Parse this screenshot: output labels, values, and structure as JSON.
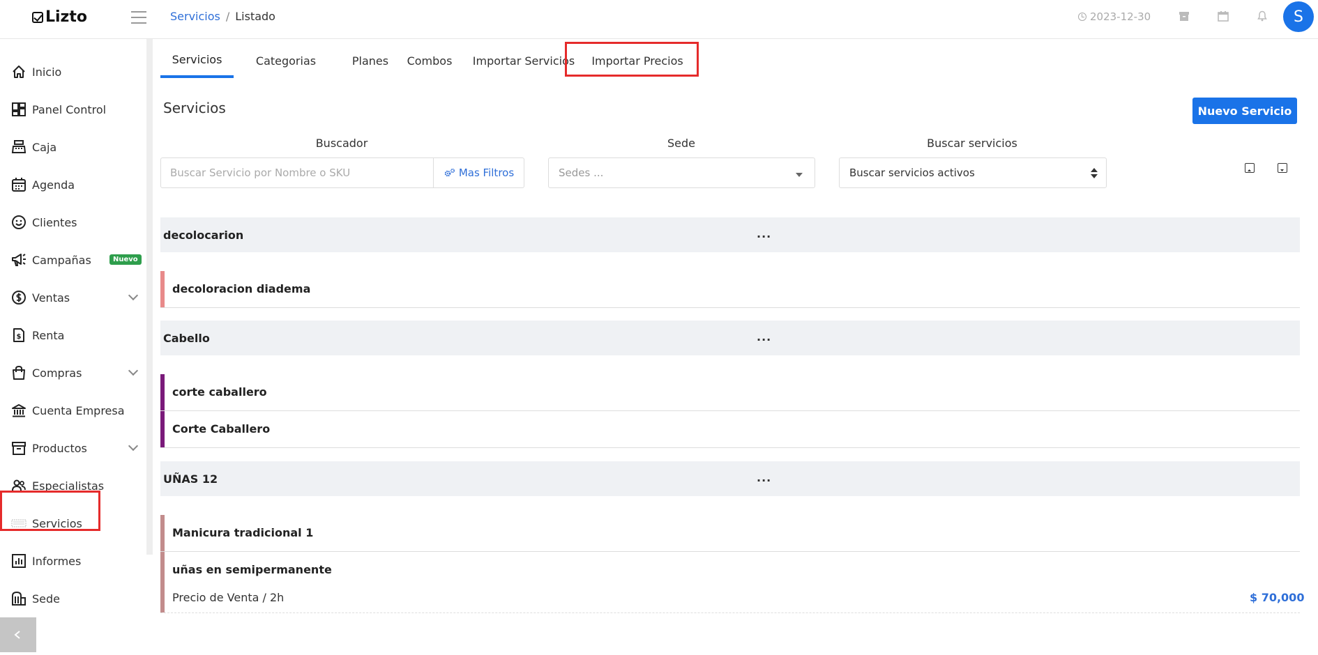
{
  "app": {
    "logo_text": "Lizto"
  },
  "breadcrumb": {
    "parent": "Servicios",
    "separator": "/",
    "current": "Listado"
  },
  "topbar": {
    "date": "2023-12-30",
    "avatar_letter": "S"
  },
  "sidebar": {
    "items": [
      {
        "label": "Inicio",
        "icon": "home-icon"
      },
      {
        "label": "Panel Control",
        "icon": "dashboard-icon"
      },
      {
        "label": "Caja",
        "icon": "cash-register-icon"
      },
      {
        "label": "Agenda",
        "icon": "calendar-icon"
      },
      {
        "label": "Clientes",
        "icon": "smiley-icon"
      },
      {
        "label": "Campañas",
        "icon": "megaphone-icon",
        "badge": "Nuevo"
      },
      {
        "label": "Ventas",
        "icon": "dollar-icon"
      },
      {
        "label": "Renta",
        "icon": "invoice-icon"
      },
      {
        "label": "Compras",
        "icon": "shopping-bag-icon"
      },
      {
        "label": "Cuenta Empresa",
        "icon": "bank-icon"
      },
      {
        "label": "Productos",
        "icon": "archive-icon"
      },
      {
        "label": "Especialistas",
        "icon": "users-icon"
      },
      {
        "label": "Servicios",
        "icon": "services-icon"
      },
      {
        "label": "Informes",
        "icon": "report-icon"
      },
      {
        "label": "Sede",
        "icon": "building-icon"
      }
    ]
  },
  "tabs": [
    {
      "label": "Servicios",
      "active": true
    },
    {
      "label": "Categorias"
    },
    {
      "label": "Planes"
    },
    {
      "label": "Combos"
    },
    {
      "label": "Importar Servicios"
    },
    {
      "label": "Importar Precios"
    }
  ],
  "main": {
    "title": "Servicios",
    "new_button": "Nuevo Servicio",
    "filters": {
      "search_label": "Buscador",
      "search_placeholder": "Buscar Servicio por Nombre o SKU",
      "more_filters": "Mas Filtros",
      "sede_label": "Sede",
      "sede_placeholder": "Sedes ...",
      "status_label": "Buscar servicios",
      "status_value": "Buscar servicios activos"
    },
    "categories": [
      {
        "name": "decolocarion",
        "menu": "...",
        "color": "#e88a8a",
        "services": [
          "decoloracion diadema"
        ]
      },
      {
        "name": "Cabello",
        "menu": "...",
        "color": "#7a1a7a",
        "services": [
          "corte caballero",
          "Corte Caballero"
        ]
      },
      {
        "name": "UÑAS 12",
        "menu": "...",
        "color": "#c28c8c",
        "services": [
          "Manicura tradicional 1",
          "uñas en semipermanente"
        ]
      }
    ],
    "price": {
      "label": "Precio de Venta / 2h",
      "value": "$ 70,000"
    }
  }
}
